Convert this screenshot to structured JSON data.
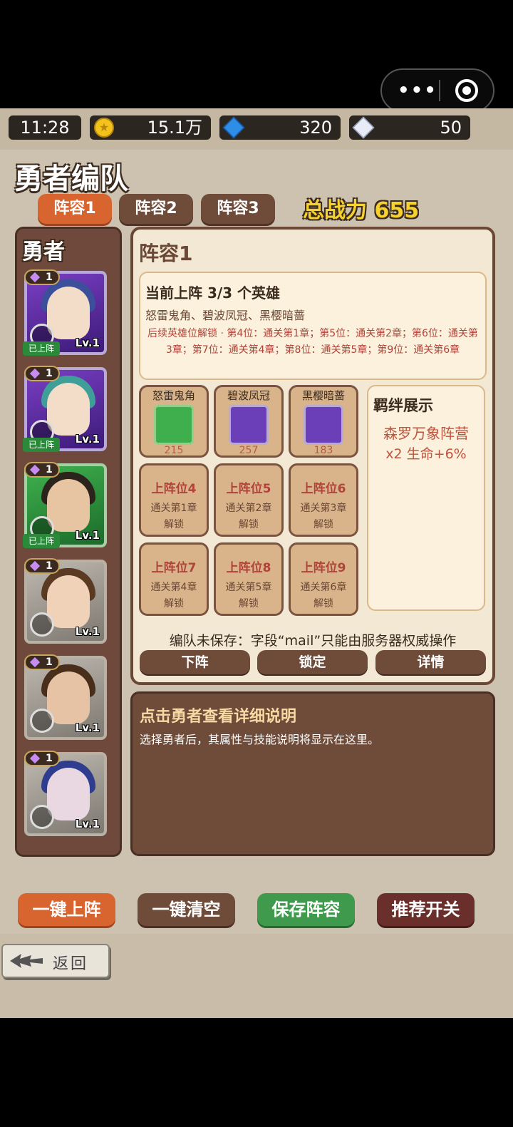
{
  "status": {
    "time": "11:28"
  },
  "resources": {
    "gold": "15.1万",
    "gems": "320",
    "diamonds": "50"
  },
  "page_title": "勇者编队",
  "tabs": [
    {
      "label": "阵容1"
    },
    {
      "label": "阵容2"
    },
    {
      "label": "阵容3"
    }
  ],
  "total_power": "总战力 655",
  "hero_list": {
    "title": "勇者",
    "heroes": [
      {
        "star": "1",
        "level": "Lv.1",
        "badge": "已上阵",
        "frame": "purple"
      },
      {
        "star": "1",
        "level": "Lv.1",
        "badge": "已上阵",
        "frame": "purple"
      },
      {
        "star": "1",
        "level": "Lv.1",
        "badge": "已上阵",
        "frame": "green"
      },
      {
        "star": "1",
        "level": "Lv.1",
        "badge": "",
        "frame": "gray"
      },
      {
        "star": "1",
        "level": "Lv.1",
        "badge": "",
        "frame": "gray"
      },
      {
        "star": "1",
        "level": "Lv.1",
        "badge": "",
        "frame": "gray"
      }
    ]
  },
  "lineup": {
    "title": "阵容1",
    "current": "当前上阵 3/3 个英雄",
    "names": "怒雷鬼角、碧波凤冠、黑樱暗蔷",
    "unlock_info": "后续英雄位解锁 · 第4位：通关第1章；第5位：通关第2章；第6位：通关第3章；第7位：通关第4章；第8位：通关第5章；第9位：通关第6章",
    "slots": [
      {
        "name": "怒雷鬼角",
        "power": "215"
      },
      {
        "name": "碧波凤冠",
        "power": "257"
      },
      {
        "name": "黑樱暗蔷",
        "power": "183"
      }
    ],
    "locked": [
      {
        "label": "上阵位4",
        "req": "通关第1章",
        "state": "解锁"
      },
      {
        "label": "上阵位5",
        "req": "通关第2章",
        "state": "解锁"
      },
      {
        "label": "上阵位6",
        "req": "通关第3章",
        "state": "解锁"
      },
      {
        "label": "上阵位7",
        "req": "通关第4章",
        "state": "解锁"
      },
      {
        "label": "上阵位8",
        "req": "通关第5章",
        "state": "解锁"
      },
      {
        "label": "上阵位9",
        "req": "通关第6章",
        "state": "解锁"
      }
    ],
    "bond": {
      "title": "羁绊展示",
      "camp": "森罗万象阵营",
      "effect": "x2  生命+6%"
    },
    "warning": "编队未保存：字段“mail”只能由服务器权威操作",
    "buttons": {
      "unequip": "下阵",
      "lock": "锁定",
      "detail": "详情"
    }
  },
  "detail": {
    "title": "点击勇者查看详细说明",
    "text": "选择勇者后，其属性与技能说明将显示在这里。"
  },
  "actions": {
    "auto_equip": "一键上阵",
    "clear": "一键清空",
    "save": "保存阵容",
    "recommend": "推荐开关"
  },
  "back": {
    "label": "返回"
  },
  "colors": {
    "accent": "#d8652f",
    "panel": "#6f4b3a",
    "save": "#3f9a4e",
    "recommend": "#6a2f2a"
  }
}
